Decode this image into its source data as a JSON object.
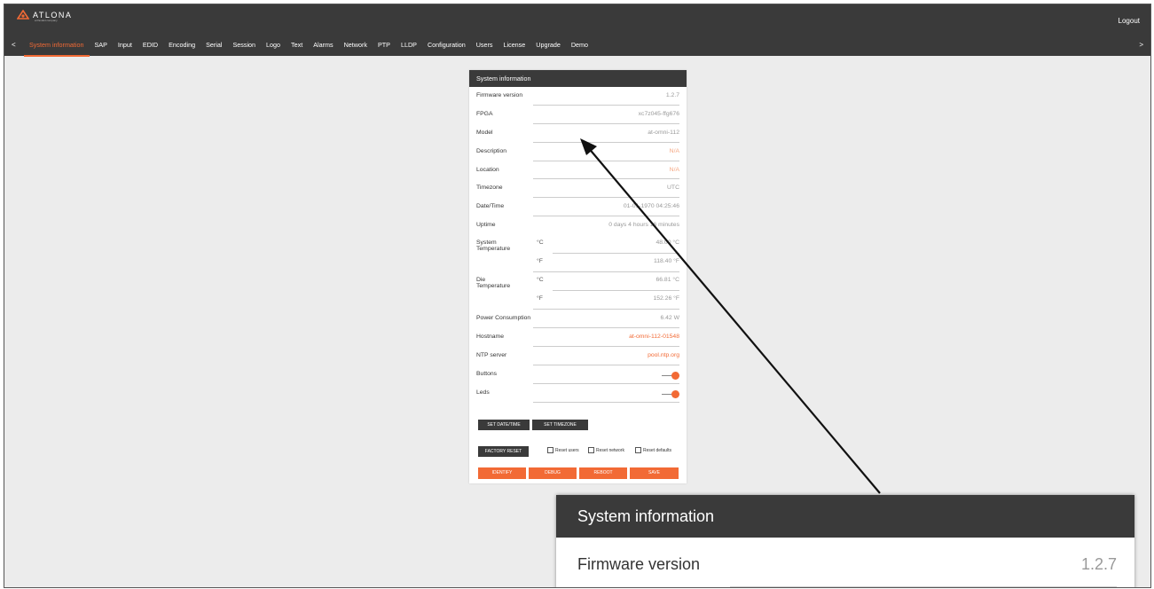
{
  "header": {
    "logo_text": "ATLONA",
    "logo_sub": "a Panduit company",
    "logout": "Logout"
  },
  "nav": {
    "prev": "<",
    "next": ">",
    "tabs": [
      "System information",
      "SAP",
      "Input",
      "EDID",
      "Encoding",
      "Serial",
      "Session",
      "Logo",
      "Text",
      "Alarms",
      "Network",
      "PTP",
      "LLDP",
      "Configuration",
      "Users",
      "License",
      "Upgrade",
      "Demo"
    ],
    "active_tab": "System information"
  },
  "panel": {
    "title": "System information",
    "firmware_label": "Firmware version",
    "firmware_value": "1.2.7",
    "fpga_label": "FPGA",
    "fpga_value": "xc7z045-ffg676",
    "model_label": "Model",
    "model_value": "at-omni-112",
    "description_label": "Description",
    "description_value": "N/A",
    "location_label": "Location",
    "location_value": "N/A",
    "timezone_label": "Timezone",
    "timezone_value": "UTC",
    "datetime_label": "Date/Time",
    "datetime_value": "01-01-1970 04:25:46",
    "uptime_label": "Uptime",
    "uptime_value": "0 days 4 hours 16 minutes",
    "sys_temp_label": "System Temperature",
    "sys_temp_c_unit": "°C",
    "sys_temp_c": "48.00 °C",
    "sys_temp_f_unit": "°F",
    "sys_temp_f": "118.40 °F",
    "die_temp_label": "Die Temperature",
    "die_temp_c_unit": "°C",
    "die_temp_c": "66.81 °C",
    "die_temp_f_unit": "°F",
    "die_temp_f": "152.26 °F",
    "power_label": "Power Consumption",
    "power_value": "6.42 W",
    "hostname_label": "Hostname",
    "hostname_value": "at-omni-112-01548",
    "ntp_label": "NTP server",
    "ntp_value": "pool.ntp.org",
    "buttons_label": "Buttons",
    "buttons_on": true,
    "leds_label": "Leds",
    "leds_on": true,
    "set_datetime": "SET DATE/TIME",
    "set_timezone": "SET TIMEZONE",
    "factory_reset": "FACTORY RESET",
    "reset_users": "Reset users",
    "reset_network": "Reset network",
    "reset_defaults": "Reset defaults",
    "identify": "IDENTIFY",
    "debug": "DEBUG",
    "reboot": "REBOOT",
    "save": "SAVE"
  },
  "callout": {
    "title": "System information",
    "firmware_label": "Firmware version",
    "firmware_value": "1.2.7"
  },
  "colors": {
    "accent": "#f26a35",
    "header_bg": "#3a3a3a",
    "page_bg": "#ececec"
  }
}
